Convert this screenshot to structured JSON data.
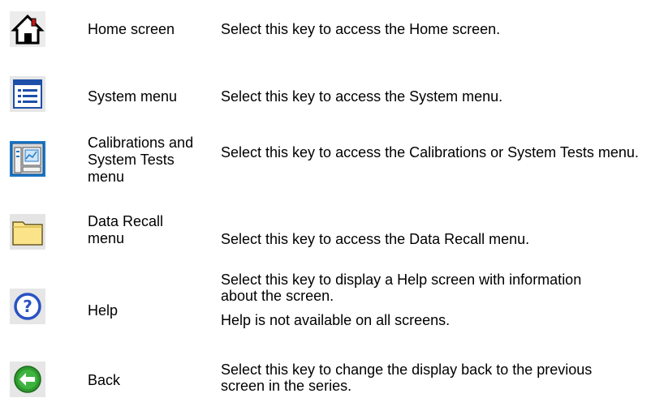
{
  "rows": [
    {
      "icon": "home-icon",
      "name": "Home screen",
      "description": [
        "Select this key to access the Home screen."
      ]
    },
    {
      "icon": "system-menu-icon",
      "name": "System menu",
      "description": [
        "Select this key to access the System menu."
      ]
    },
    {
      "icon": "calibrations-icon",
      "name": "Calibrations and System Tests menu",
      "description": [
        "Select this key to access the Calibrations or System Tests menu."
      ]
    },
    {
      "icon": "folder-icon",
      "name": "Data Recall menu",
      "description": [
        "Select this key to access the Data Recall menu."
      ]
    },
    {
      "icon": "help-icon",
      "name": "Help",
      "description": [
        "Select this key to display a Help screen with information about the screen.",
        "Help is not available on all screens."
      ]
    },
    {
      "icon": "back-arrow-icon",
      "name": "Back",
      "description": [
        "Select this key to change the display back to the previous screen in the series."
      ]
    }
  ]
}
